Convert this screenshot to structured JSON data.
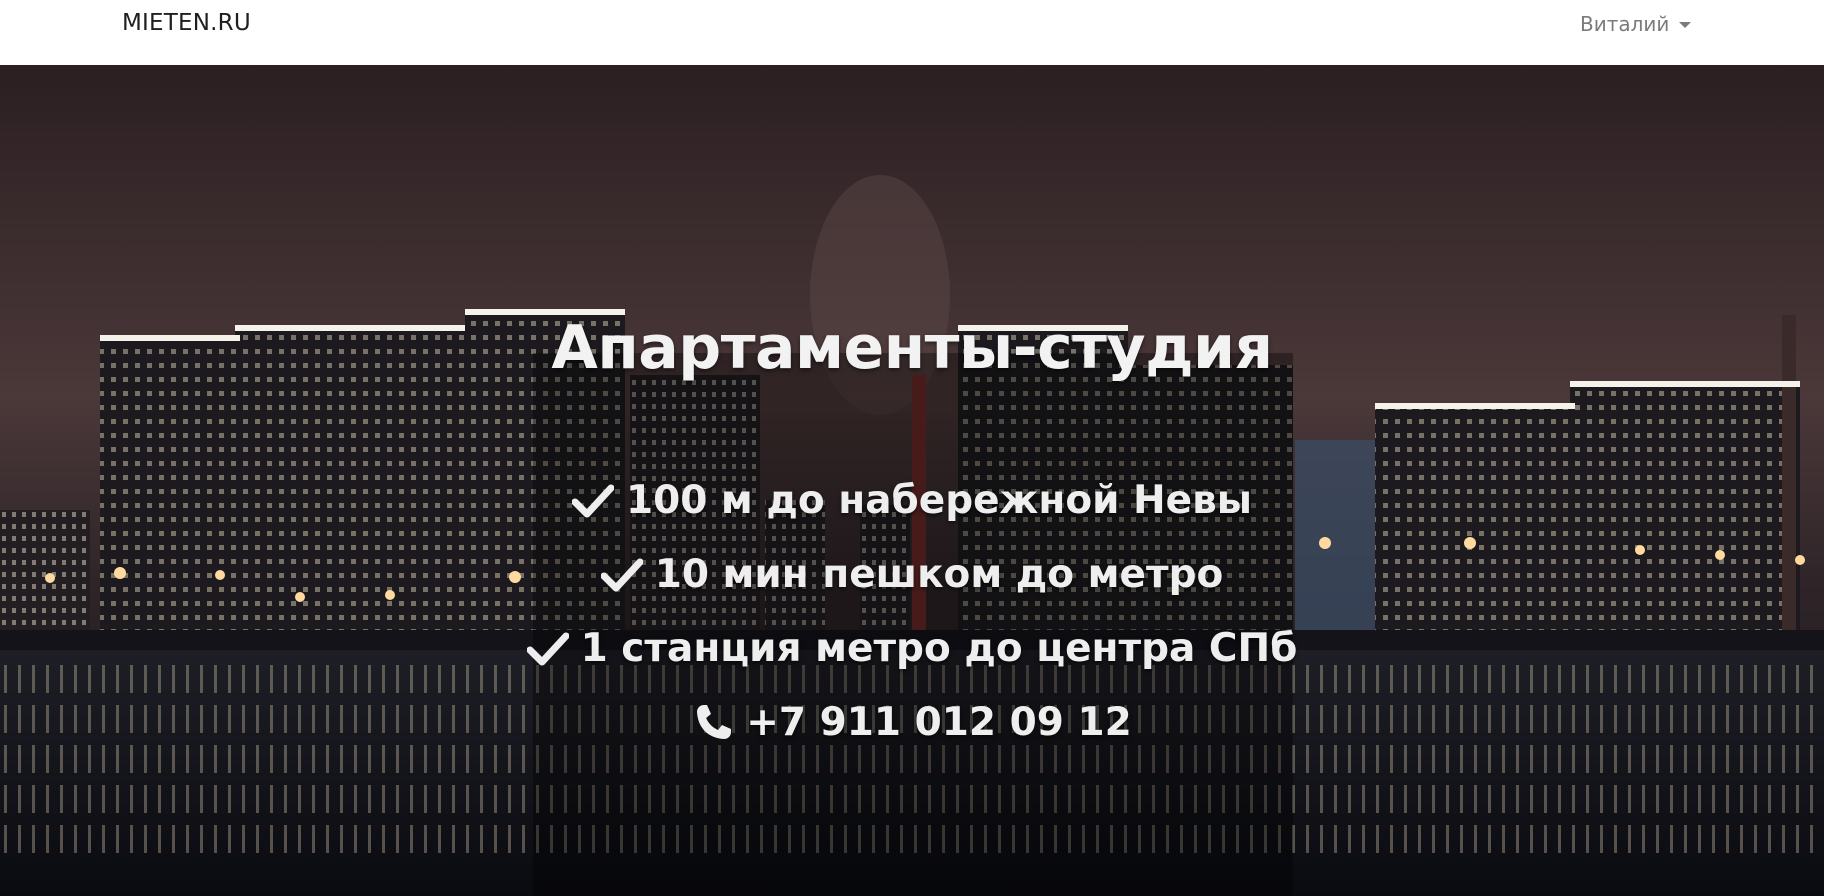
{
  "navbar": {
    "brand": "MIETEN.RU",
    "user_name": "Виталий"
  },
  "hero": {
    "title": "Апартаменты-студия",
    "features": [
      {
        "icon": "check-icon",
        "text": "100 м до набережной Невы"
      },
      {
        "icon": "check-icon",
        "text": "10 мин пешком до метро"
      },
      {
        "icon": "check-icon",
        "text": "1 станция метро до центра СПб"
      }
    ],
    "phone": {
      "icon": "phone-icon",
      "text": "+7 911 012 09 12"
    }
  },
  "colors": {
    "navbar_bg": "#ffffff",
    "brand_text": "#1f1f1f",
    "user_text": "#7b7b7b",
    "hero_text": "#eeeeee"
  }
}
